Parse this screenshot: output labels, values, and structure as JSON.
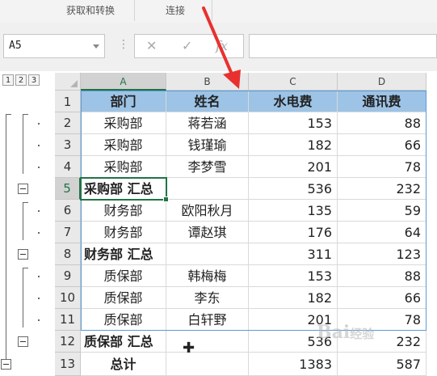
{
  "ribbon": {
    "groups": [
      "获取和转换",
      "连接"
    ]
  },
  "formula_bar": {
    "name_box": "A5",
    "cancel_icon": "✕",
    "enter_icon": "✓",
    "fx_label": "fx",
    "formula": ""
  },
  "outline_levels": [
    "1",
    "2",
    "3"
  ],
  "columns": [
    "A",
    "B",
    "C",
    "D"
  ],
  "header_row": {
    "row": "1",
    "cells": [
      "部门",
      "姓名",
      "水电费",
      "通讯费"
    ]
  },
  "rows": [
    {
      "row": "2",
      "dept": "采购部",
      "name": "蒋若涵",
      "water": "153",
      "phone": "88"
    },
    {
      "row": "3",
      "dept": "采购部",
      "name": "钱瑾瑜",
      "water": "182",
      "phone": "66"
    },
    {
      "row": "4",
      "dept": "采购部",
      "name": "李梦雪",
      "water": "201",
      "phone": "78"
    },
    {
      "row": "5",
      "dept": "采购部 汇总",
      "name": "",
      "water": "536",
      "phone": "232"
    },
    {
      "row": "6",
      "dept": "财务部",
      "name": "欧阳秋月",
      "water": "135",
      "phone": "59"
    },
    {
      "row": "7",
      "dept": "财务部",
      "name": "谭赵琪",
      "water": "176",
      "phone": "64"
    },
    {
      "row": "8",
      "dept": "财务部 汇总",
      "name": "",
      "water": "311",
      "phone": "123"
    },
    {
      "row": "9",
      "dept": "质保部",
      "name": "韩梅梅",
      "water": "153",
      "phone": "88"
    },
    {
      "row": "10",
      "dept": "质保部",
      "name": "李东",
      "water": "182",
      "phone": "66"
    },
    {
      "row": "11",
      "dept": "质保部",
      "name": "白轩野",
      "water": "201",
      "phone": "78"
    },
    {
      "row": "12",
      "dept": "质保部 汇总",
      "name": "",
      "water": "536",
      "phone": "232"
    },
    {
      "row": "13",
      "dept": "总计",
      "name": "",
      "water": "1383",
      "phone": "587"
    }
  ],
  "selected_cell": "A5",
  "colors": {
    "header_fill": "#9dc3e6",
    "selection": "#217346",
    "arrow": "#e8312f"
  }
}
